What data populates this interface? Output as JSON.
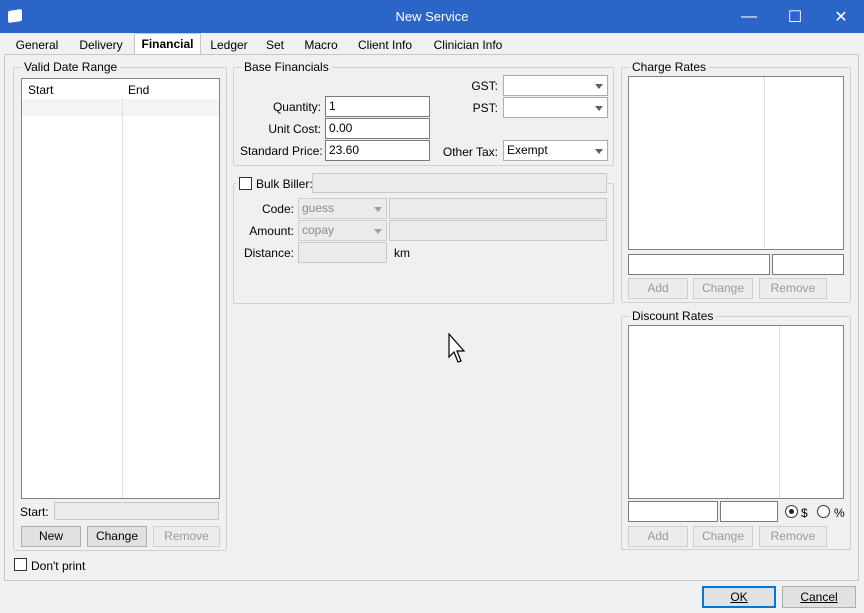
{
  "window": {
    "title": "New Service",
    "controls": {
      "minimize": "—",
      "maximize": "☐",
      "close": "✕"
    }
  },
  "tabs": [
    {
      "label": "General"
    },
    {
      "label": "Delivery"
    },
    {
      "label": "Financial",
      "active": true
    },
    {
      "label": "Ledger"
    },
    {
      "label": "Set"
    },
    {
      "label": "Macro"
    },
    {
      "label": "Client Info"
    },
    {
      "label": "Clinician Info"
    }
  ],
  "valid_date_range": {
    "legend": "Valid Date Range",
    "columns": [
      "Start",
      "End"
    ],
    "start_label": "Start:",
    "start_value": "",
    "buttons": {
      "new": "New",
      "change": "Change",
      "remove": "Remove"
    }
  },
  "base_financials": {
    "legend": "Base Financials",
    "quantity_label": "Quantity:",
    "quantity_value": "1",
    "unit_cost_label": "Unit Cost:",
    "unit_cost_value": "0.00",
    "standard_price_label": "Standard Price:",
    "standard_price_value": "23.60",
    "gst_label": "GST:",
    "gst_value": "",
    "pst_label": "PST:",
    "pst_value": "",
    "other_tax_label": "Other Tax:",
    "other_tax_value": "Exempt"
  },
  "bulk_biller": {
    "label": "Bulk Biller:",
    "checked": false,
    "value": "",
    "code_label": "Code:",
    "code_value": "guess",
    "code_desc": "",
    "amount_label": "Amount:",
    "amount_value": "copay",
    "amount_desc": "",
    "distance_label": "Distance:",
    "distance_value": "",
    "distance_unit": "km"
  },
  "charge_rates": {
    "legend": "Charge Rates",
    "input1": "",
    "input2": "",
    "buttons": {
      "add": "Add",
      "change": "Change",
      "remove": "Remove"
    }
  },
  "discount_rates": {
    "legend": "Discount Rates",
    "input1": "",
    "input2": "",
    "radio_dollar": "$",
    "radio_percent": "%",
    "selected": "$",
    "buttons": {
      "add": "Add",
      "change": "Change",
      "remove": "Remove"
    }
  },
  "dont_print": {
    "label": "Don't print",
    "checked": false
  },
  "footer": {
    "ok": "OK",
    "cancel": "Cancel"
  }
}
